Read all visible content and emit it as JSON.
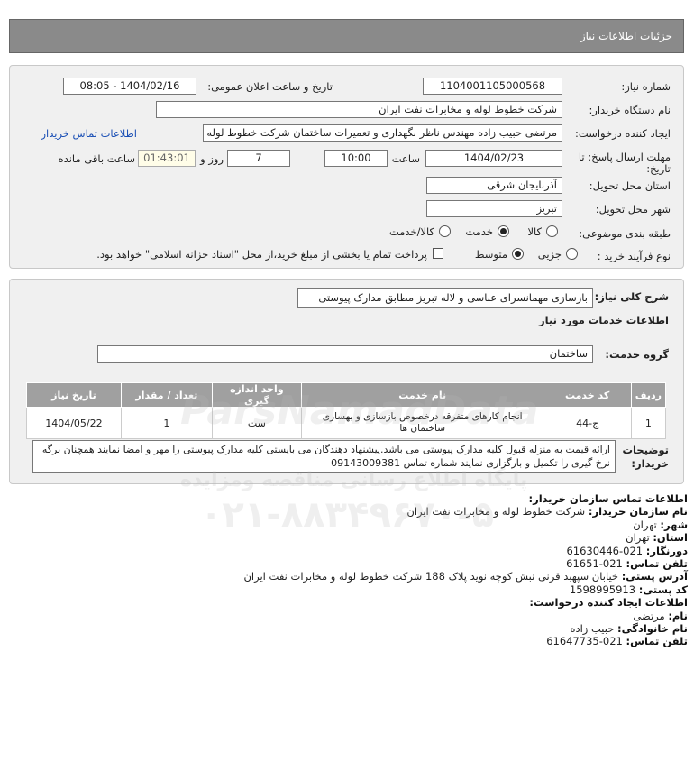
{
  "header": {
    "title": "جزئیات اطلاعات نیاز"
  },
  "form": {
    "need_number_label": "شماره نیاز:",
    "need_number": "1104001105000568",
    "announce_label": "تاریخ و ساعت اعلان عمومی:",
    "announce_value": "1404/02/16 - 08:05",
    "buyer_label": "نام دستگاه خریدار:",
    "buyer_value": "شرکت خطوط لوله و مخابرات نفت ایران",
    "creator_label": "ایجاد کننده درخواست:",
    "creator_value": "مرتضی حبیب زاده مهندس ناظر نگهداری و تعمیرات ساختمان شرکت خطوط لوله",
    "buyer_contact_link": "اطلاعات تماس خریدار",
    "deadline_label_1": "مهلت ارسال پاسخ: تا",
    "deadline_label_2": "تاریخ:",
    "deadline_date": "1404/02/23",
    "hour_label": "ساعت",
    "deadline_hour": "10:00",
    "days_value": "7",
    "days_label": "روز و",
    "remaining_time": "01:43:01",
    "remaining_label": "ساعت باقی مانده",
    "province_label": "استان محل تحویل:",
    "province_value": "آذربایجان شرقی",
    "city_label": "شهر محل تحویل:",
    "city_value": "تبریز",
    "category_label": "طبقه بندی موضوعی:",
    "category_options": [
      "کالا",
      "خدمت",
      "کالا/خدمت"
    ],
    "category_selected": "خدمت",
    "process_label": "نوع فرآیند خرید :",
    "process_options": [
      "جزیی",
      "متوسط"
    ],
    "process_selected": "متوسط",
    "treasury_text": "پرداخت تمام یا بخشی از مبلغ خرید،از محل \"اسناد خزانه اسلامی\" خواهد بود."
  },
  "need": {
    "summary_label": "شرح کلی نیاز:",
    "summary_value": "بازسازی مهمانسرای عباسی و لاله تبریز مطابق مدارک پیوستی",
    "services_heading": "اطلاعات خدمات مورد نیاز",
    "service_group_label": "گروه خدمت:",
    "service_group_value": "ساختمان",
    "table": {
      "headers": [
        "ردیف",
        "کد خدمت",
        "نام خدمت",
        "واحد اندازه گیری",
        "تعداد / مقدار",
        "تاریخ نیاز"
      ],
      "rows": [
        [
          "1",
          "ج-44",
          "انجام کارهای متفرقه درخصوص بازسازی و بهسازی ساختمان ها",
          "ست",
          "1",
          "1404/05/22"
        ]
      ]
    },
    "buyer_notes_label": "توضیحات خریدار:",
    "buyer_notes": "ارائه قیمت به منزله قبول کلیه مدارک پیوستی می باشد.پیشنهاد دهندگان می بایستی کلیه مدارک پیوستی را مهر و امضا نمایند همچنان برگه نرخ گیری را تکمیل و بارگزاری نمایند شماره تماس 09143009381"
  },
  "contact": {
    "org_heading": "اطلاعات تماس سازمان خریدار:",
    "org_name_label": "نام سازمان خریدار:",
    "org_name": "شرکت خطوط لوله و مخابرات نفت ایران",
    "city_label": "شهر:",
    "city": "تهران",
    "province_label": "استان:",
    "province": "تهران",
    "fax_label": "دورنگار:",
    "fax": "021-61630446",
    "phone_label": "تلفن تماس:",
    "phone": "021-61651",
    "address_label": "آدرس پستی:",
    "address": "خیابان سپهبد قرنی نبش کوچه نوید پلاک 188 شرکت خطوط لوله و مخابرات نفت ایران",
    "postal_label": "کد پستی:",
    "postal": "1598995913",
    "creator_heading": "اطلاعات ایجاد کننده درخواست:",
    "first_name_label": "نام:",
    "first_name": "مرتضی",
    "last_name_label": "نام خانوادگی:",
    "last_name": "حبیب زاده",
    "creator_phone_label": "تلفن تماس:",
    "creator_phone": "021-61647735"
  },
  "watermark": {
    "brand": "ParsNamadData",
    "site_line": "پایگاه اطلاع رسانی مناقصه ومزایده",
    "phone_line": "۰۲۱-۸۸۳۴۹۶۷۰-۵"
  }
}
